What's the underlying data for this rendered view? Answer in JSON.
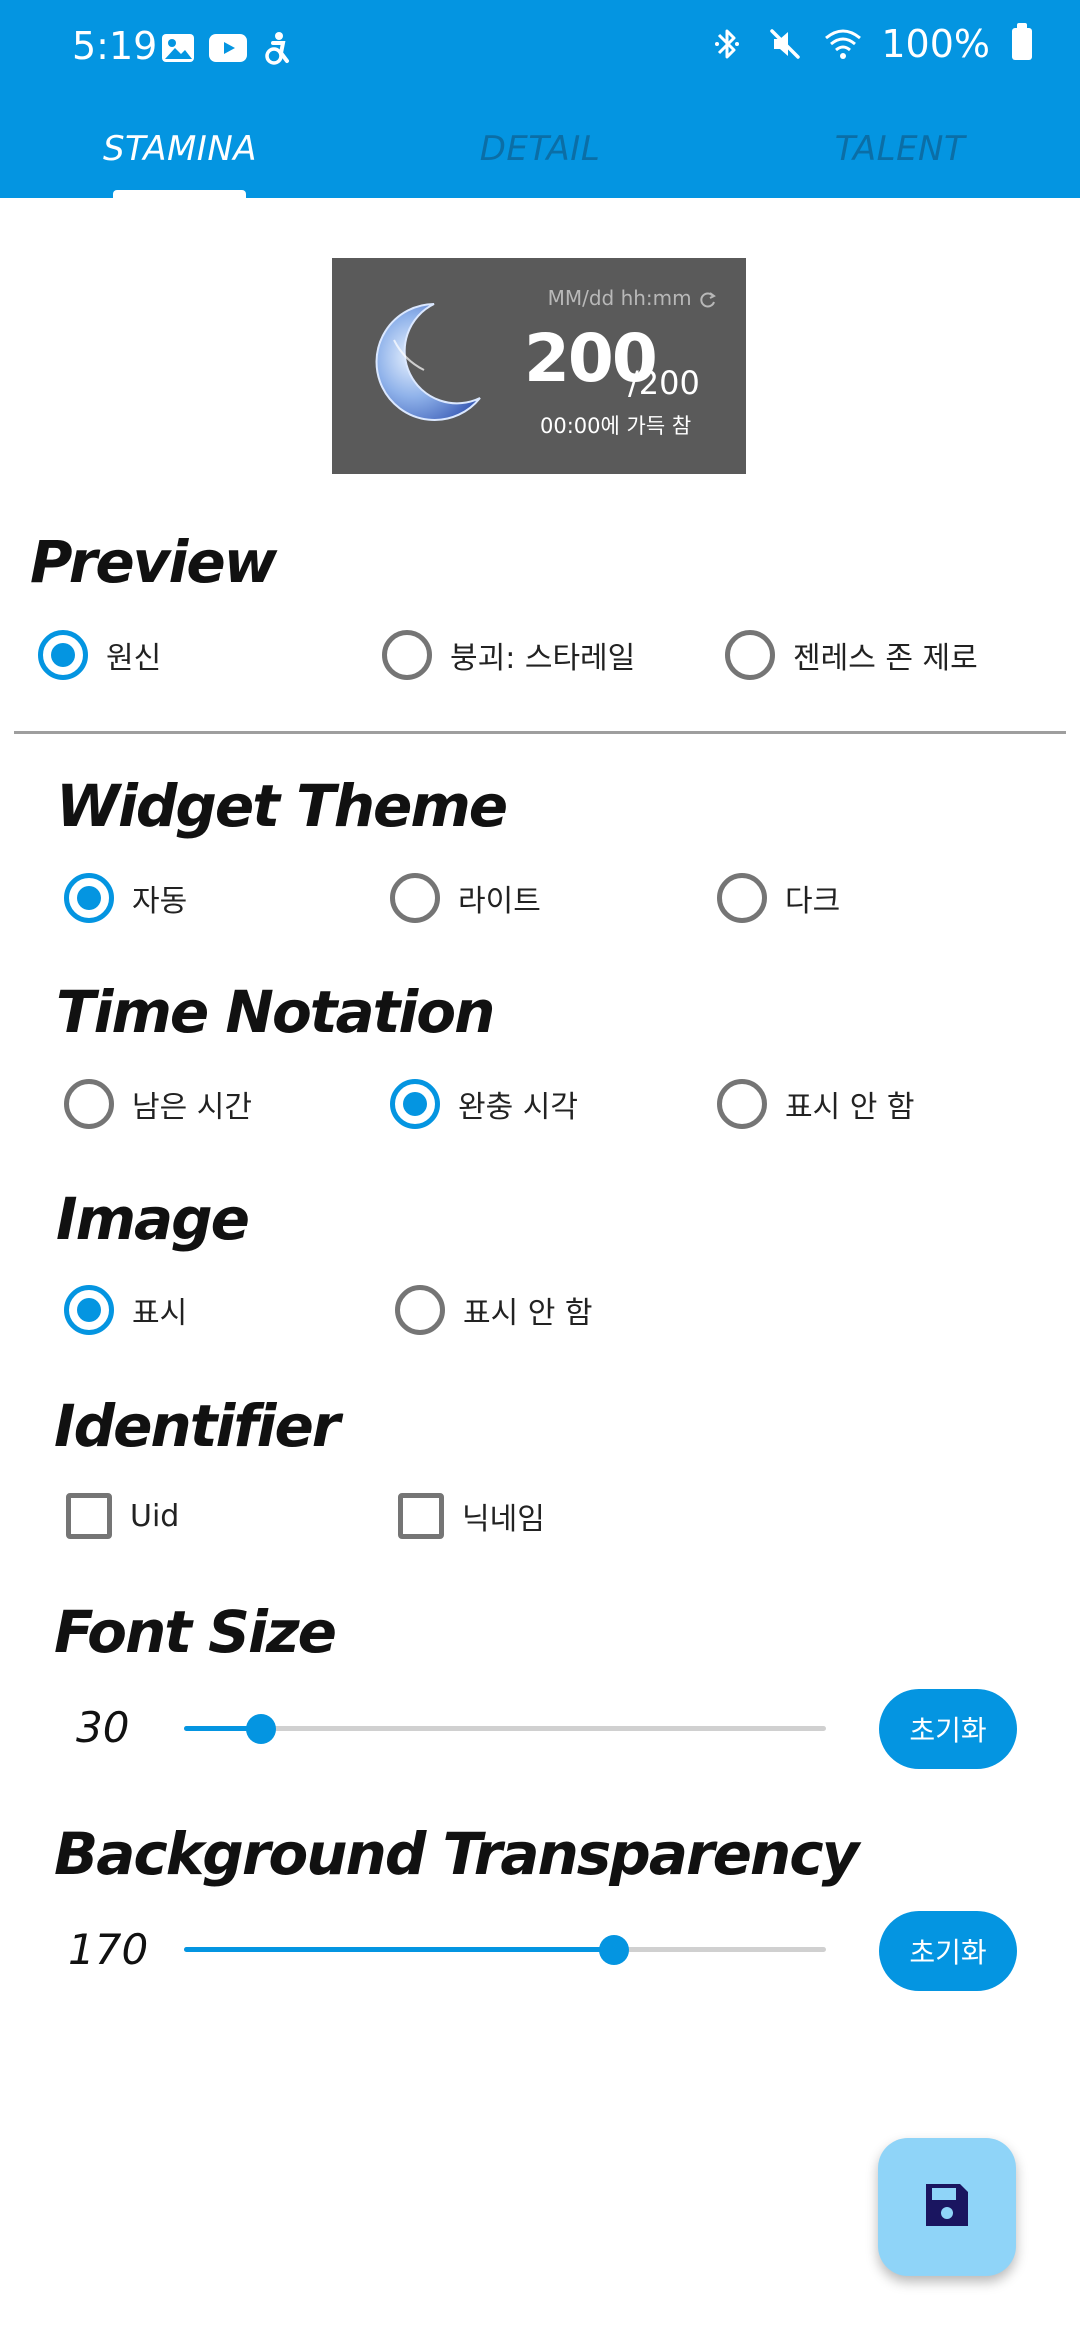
{
  "status_bar": {
    "time": "5:19",
    "battery": "100%",
    "left_icons": [
      "gallery-icon",
      "youtube-icon",
      "accessibility-icon"
    ],
    "right_icons": [
      "bluetooth-icon",
      "mute-icon",
      "wifi-icon",
      "battery-icon"
    ]
  },
  "tabs": [
    {
      "label": "STAMINA",
      "active": true
    },
    {
      "label": "DETAIL",
      "active": false
    },
    {
      "label": "TALENT",
      "active": false
    }
  ],
  "widget_preview": {
    "date_placeholder": "MM/dd hh:mm",
    "value": "200",
    "max": "/200",
    "full_text": "00:00에 가득 참",
    "icon": "crescent-moon-icon"
  },
  "preview": {
    "title": "Preview",
    "options": [
      "원신",
      "붕괴: 스타레일",
      "젠레스 존 제로"
    ],
    "selected_index": 0
  },
  "widget_theme": {
    "title": "Widget Theme",
    "options": [
      "자동",
      "라이트",
      "다크"
    ],
    "selected_index": 0
  },
  "time_notation": {
    "title": "Time Notation",
    "options": [
      "남은 시간",
      "완충 시각",
      "표시 안 함"
    ],
    "selected_index": 1
  },
  "image": {
    "title": "Image",
    "options": [
      "표시",
      "표시 안 함"
    ],
    "selected_index": 0
  },
  "identifier": {
    "title": "Identifier",
    "options": [
      "Uid",
      "닉네임"
    ],
    "checked": [
      false,
      false
    ]
  },
  "font_size": {
    "title": "Font Size",
    "value": "30",
    "fraction": 0.12,
    "reset_label": "초기화"
  },
  "background_transparency": {
    "title": "Background Transparency",
    "value": "170",
    "fraction": 0.67,
    "reset_label": "초기화"
  },
  "fab": {
    "icon": "save-icon"
  },
  "colors": {
    "primary": "#0495e1",
    "fab": "#8fd4f8",
    "widget_bg": "#5a5a5a"
  }
}
